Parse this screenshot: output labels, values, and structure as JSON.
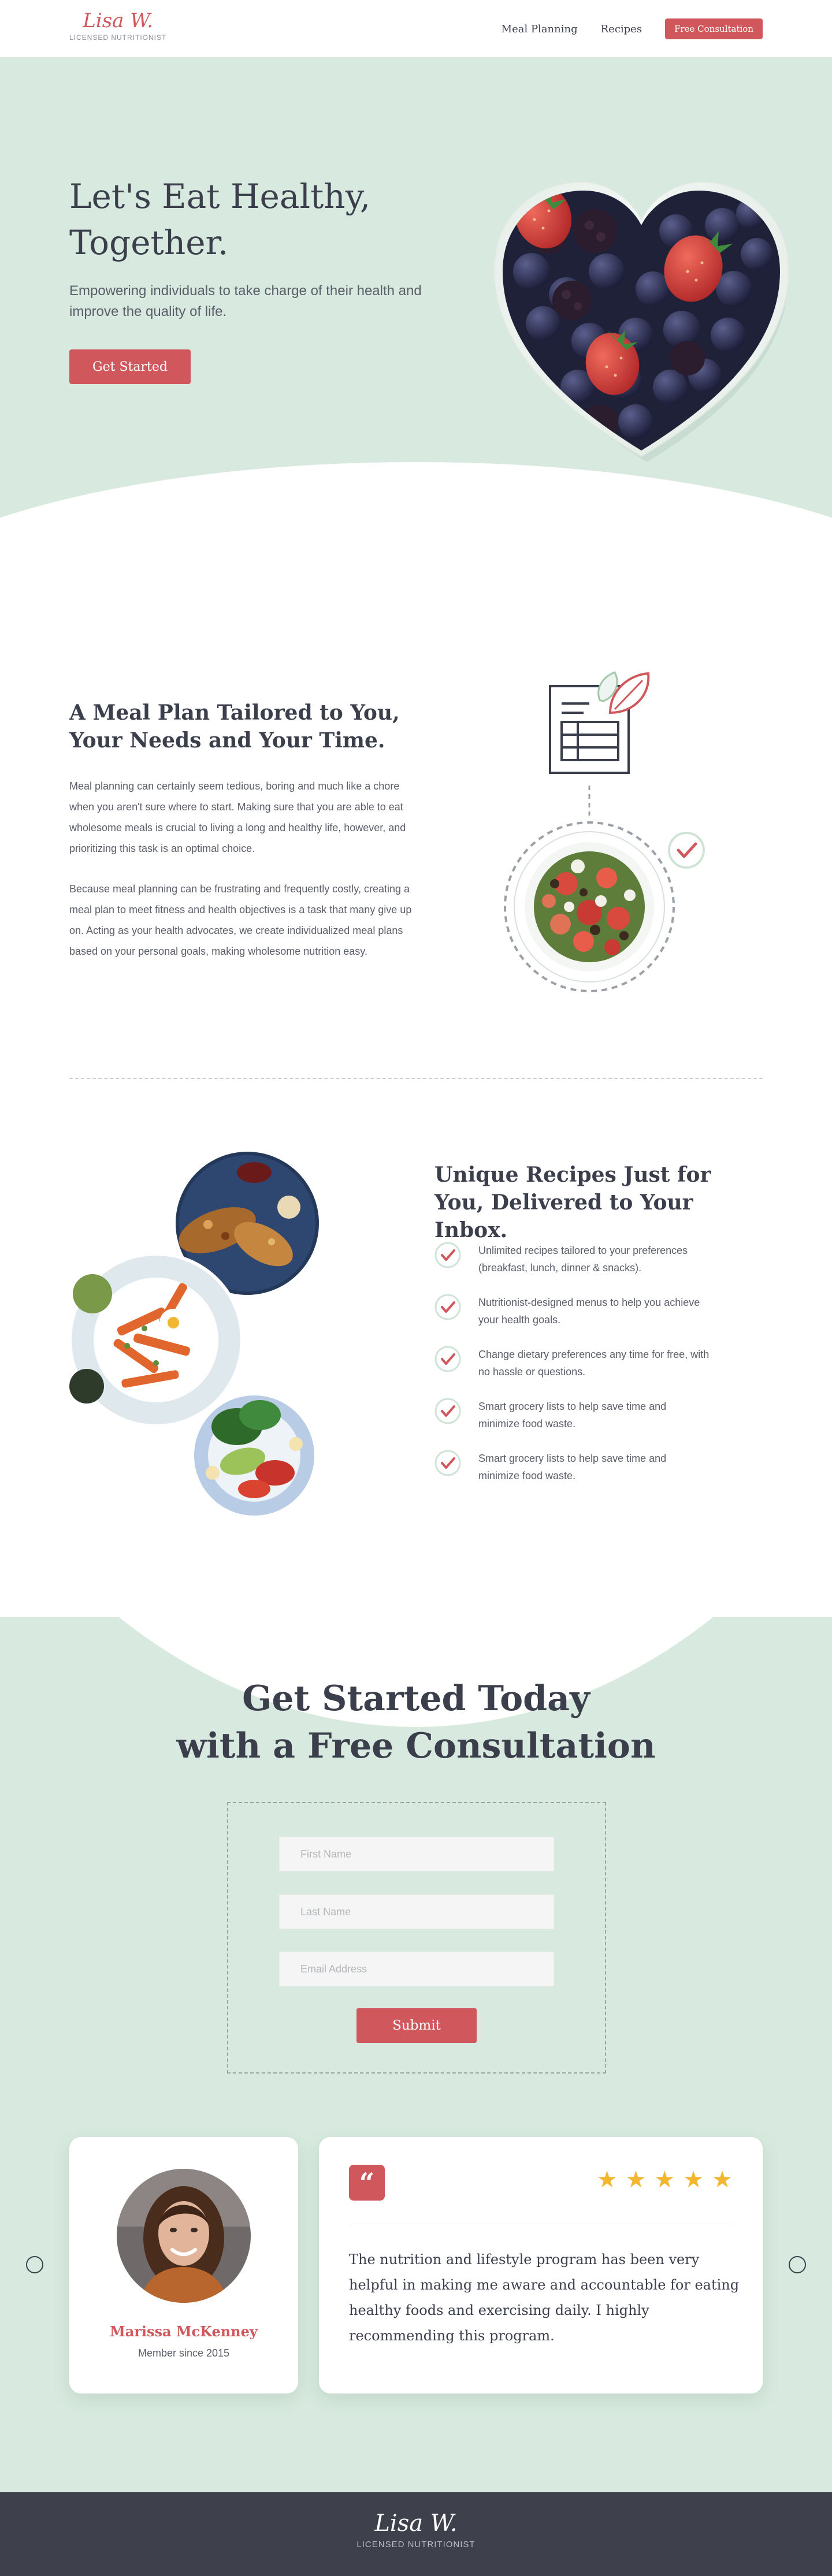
{
  "header": {
    "logo_script": "Lisa W.",
    "logo_sub": "LICENSED NUTRITIONIST",
    "nav": [
      "Meal Planning",
      "Recipes"
    ],
    "cta": "Free Consultation"
  },
  "hero": {
    "title": "Let's Eat Healthy, Together.",
    "text": "Empowering individuals to take charge of their health and improve the quality of life.",
    "button": "Get Started"
  },
  "meal_plan": {
    "title": "A Meal Plan Tailored to You, Your Needs and Your Time.",
    "p1": "Meal planning can certainly seem tedious, boring and much like a chore when you aren't sure where to start. Making sure that you are able to eat wholesome meals is crucial to living a long and healthy life, however, and prioritizing this task is an optimal choice.",
    "p2": "Because meal planning can be frustrating and frequently costly, creating a meal plan to meet fitness and health objectives is a task that many give up on. Acting as your health advocates, we create individualized meal plans based on your personal goals, making wholesome nutrition easy."
  },
  "recipes": {
    "title": "Unique Recipes Just for You, Delivered to Your Inbox.",
    "items": [
      "Unlimited recipes tailored to your preferences (breakfast, lunch, dinner & snacks).",
      "Nutritionist-designed menus to help you achieve your health goals.",
      "Change dietary preferences any time for free, with no hassle or questions.",
      "Smart grocery lists to help save time and minimize food waste.",
      "Smart grocery lists to help save time and minimize food waste."
    ]
  },
  "consultation": {
    "title_line1": "Get Started Today",
    "title_line2": "with a Free Consultation",
    "first_name_placeholder": "First Name",
    "last_name_placeholder": "Last Name",
    "email_placeholder": "Email Address",
    "submit": "Submit"
  },
  "testimonial": {
    "name": "Marissa McKenney",
    "since": "Member since 2015",
    "quote_mark": "“",
    "stars": 5,
    "quote": "The nutrition and lifestyle program has been very helpful in making me aware and accountable for eating healthy foods and exercising daily. I highly recommending this program."
  },
  "footer": {
    "logo_script": "Lisa W.",
    "logo_sub": "LICENSED NUTRITIONIST"
  },
  "colors": {
    "accent": "#d0575c",
    "mint": "#d8eadf",
    "text": "#3b3f4c",
    "footer": "#3e404c",
    "star": "#f2b630"
  }
}
